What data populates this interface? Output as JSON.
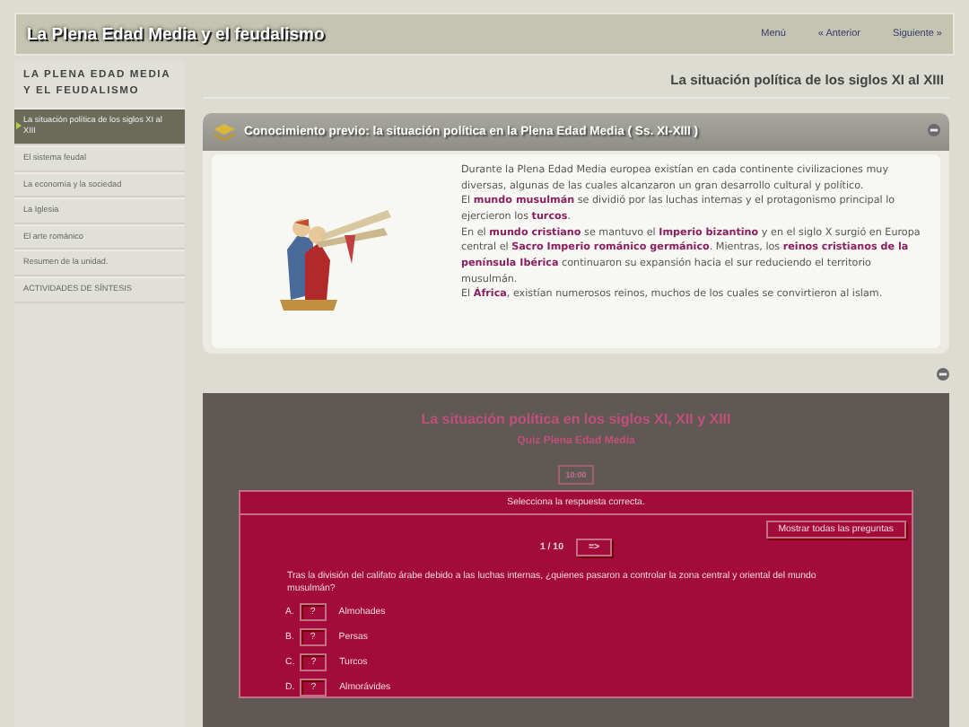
{
  "header": {
    "title": "La Plena Edad Media y el feudalismo",
    "nav": [
      "Menú",
      "« Anterior",
      "Siguiente »"
    ]
  },
  "sidebar": {
    "heading": "LA PLENA EDAD MEDIA Y EL FEUDALISMO",
    "items": [
      {
        "label": "La situación política de los siglos XI al XIII",
        "selected": true
      },
      {
        "label": "El sistema feudal",
        "selected": false
      },
      {
        "label": "La economía y la sociedad",
        "selected": false
      },
      {
        "label": "La Iglesia",
        "selected": false
      },
      {
        "label": "El arte románico",
        "selected": false
      },
      {
        "label": "Resumen de la unidad.",
        "selected": false
      },
      {
        "label": "ACTIVIDADES DE SÍNTESIS",
        "selected": false
      }
    ]
  },
  "page_title": "La situación política de los siglos XI al XIII",
  "info_box": {
    "title": "Conocimiento previo: la situación política en la Plena Edad Media ( Ss. XI-XIII )",
    "expanded": true,
    "bullets": [
      "Durante la Plena Edad Media europea existían en cada continente civilizaciones muy diversas, algunas de las cuales alcanzaron un gran desarrollo cultural y político.",
      "El **mundo musulmán** se dividió por las luchas internas y el protagonismo principal lo ejercieron los **turcos**.",
      "En el **mundo cristiano** se mantuvo el **Imperio bizantino** y en el siglo X surgió en Europa central el **Sacro Imperio románico germánico**. Mientras, los **reinos cristianos de la península Ibérica** continuaron su expansión hacia el sur reduciendo el territorio musulmán.",
      "El **África**, existían numerosos reinos, muchos de los cuales se convirtieron al islam."
    ]
  },
  "quiz": {
    "expanded": true,
    "title": "La situación política en los siglos XI, XII y XIII",
    "subtitle": "Quiz Plena Edad Media",
    "timer": "10:00",
    "instruction": "Selecciona la respuesta correcta.",
    "show_all_button": "Mostrar todas las preguntas",
    "progress": "1 / 10",
    "next_button": "=>",
    "question": "Tras la división del califato árabe debido a las luchas internas, ¿quienes pasaron a controlar la zona central y oriental del mundo musulmán?",
    "options": [
      {
        "letter": "A.",
        "mark": "?",
        "text": "Almohades"
      },
      {
        "letter": "B.",
        "mark": "?",
        "text": "Persas"
      },
      {
        "letter": "C.",
        "mark": "?",
        "text": "Turcos"
      },
      {
        "letter": "D.",
        "mark": "?",
        "text": "Almorávides"
      }
    ]
  }
}
